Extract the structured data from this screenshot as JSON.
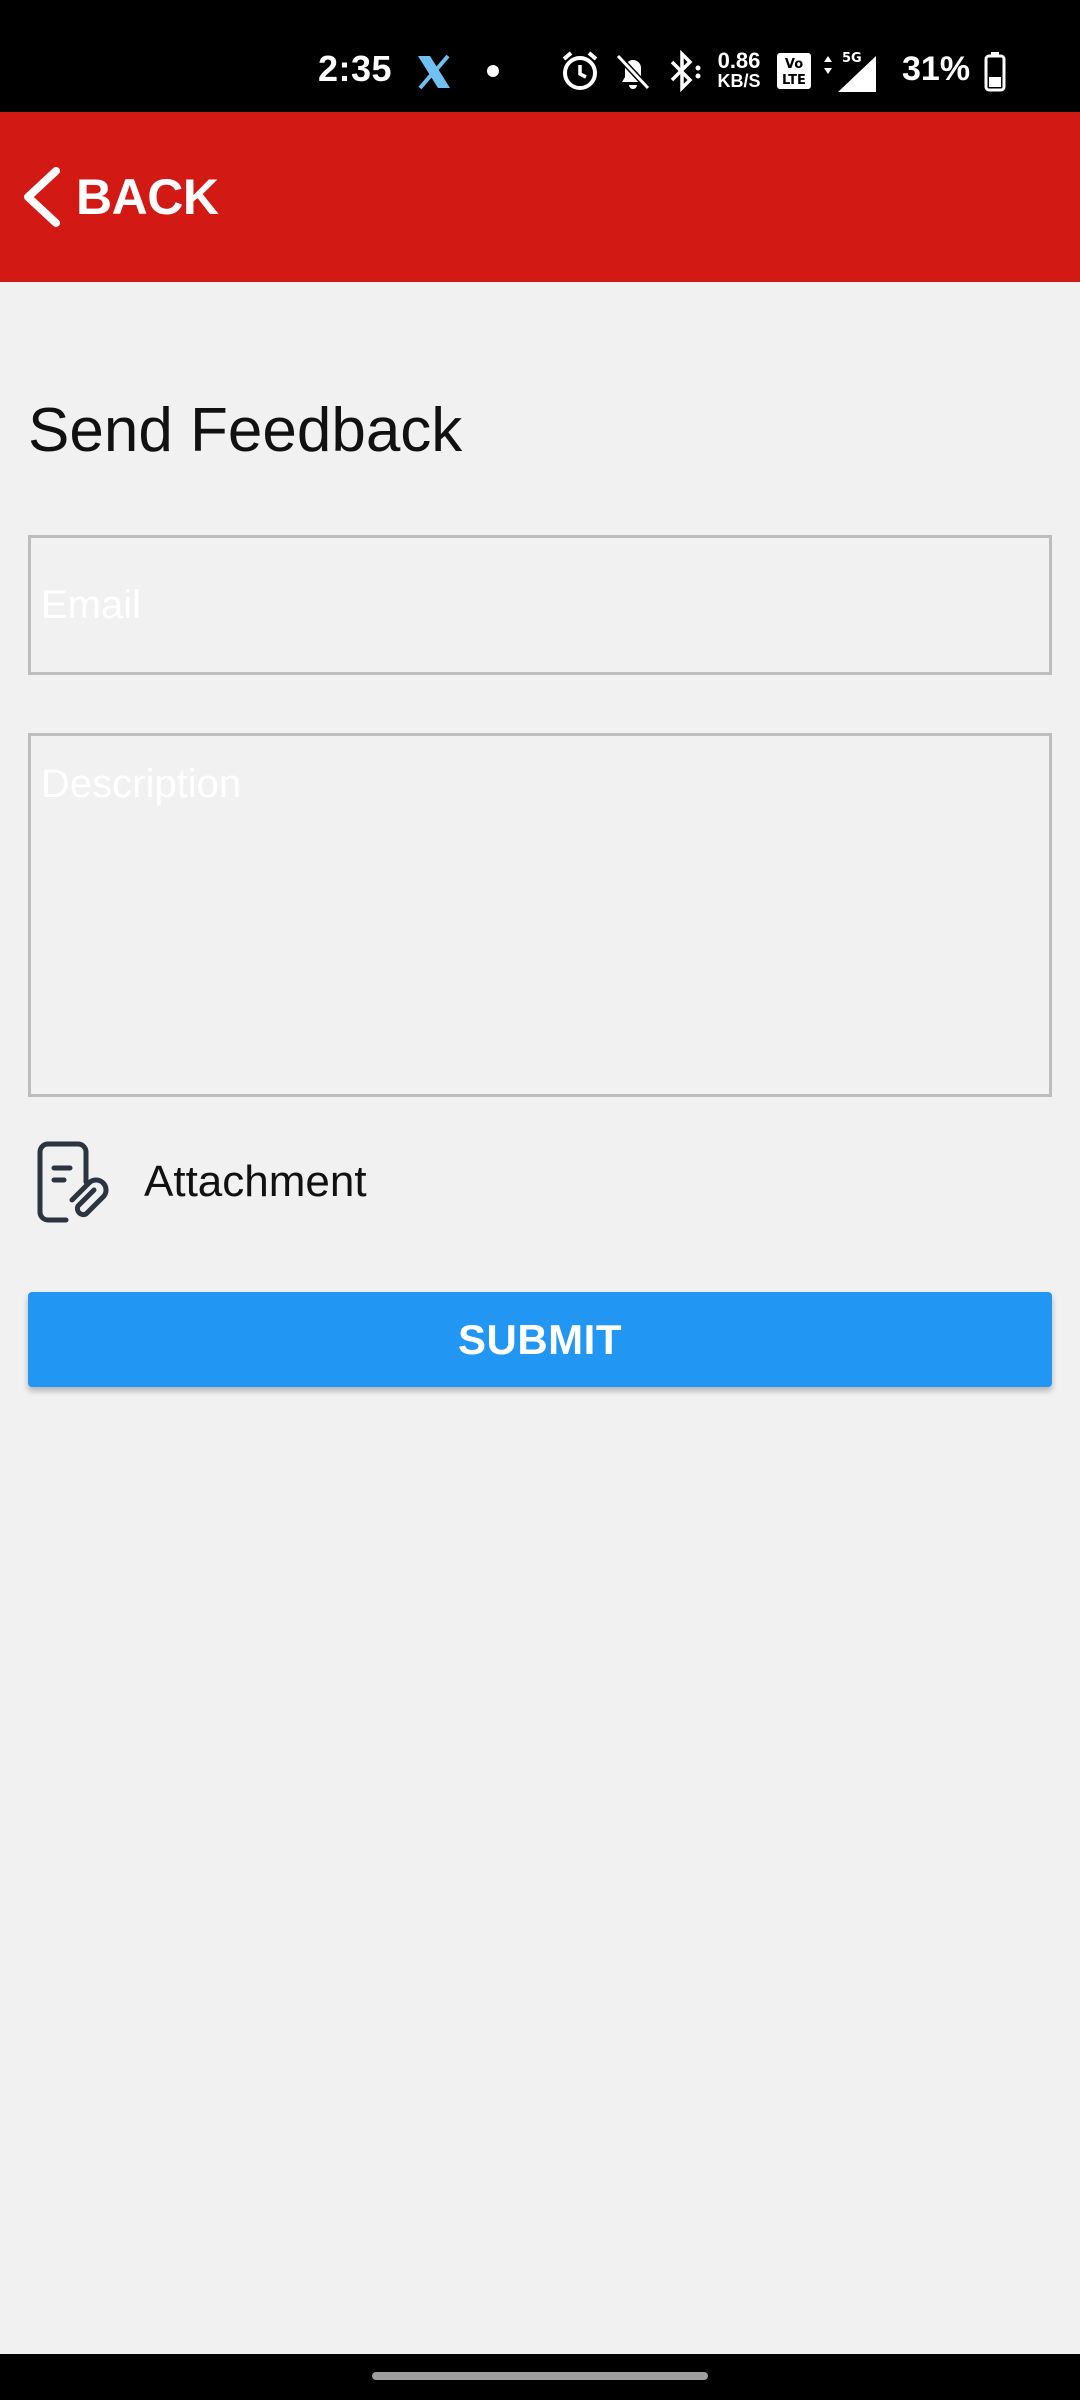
{
  "status_bar": {
    "time": "2:35",
    "net_speed_value": "0.86",
    "net_speed_unit": "KB/S",
    "battery_percent": "31%",
    "icons": [
      "x-app-icon",
      "notification-dot-icon",
      "alarm-icon",
      "bell-off-icon",
      "bluetooth-icon",
      "volte-icon",
      "5g-signal-icon",
      "battery-icon"
    ]
  },
  "header": {
    "back_label": "BACK",
    "color": "#d21914"
  },
  "main": {
    "title": "Send Feedback",
    "email_placeholder": "Email",
    "description_placeholder": "Description",
    "attachment_label": "Attachment",
    "submit_label": "SUBMIT",
    "submit_color": "#2196f3"
  }
}
